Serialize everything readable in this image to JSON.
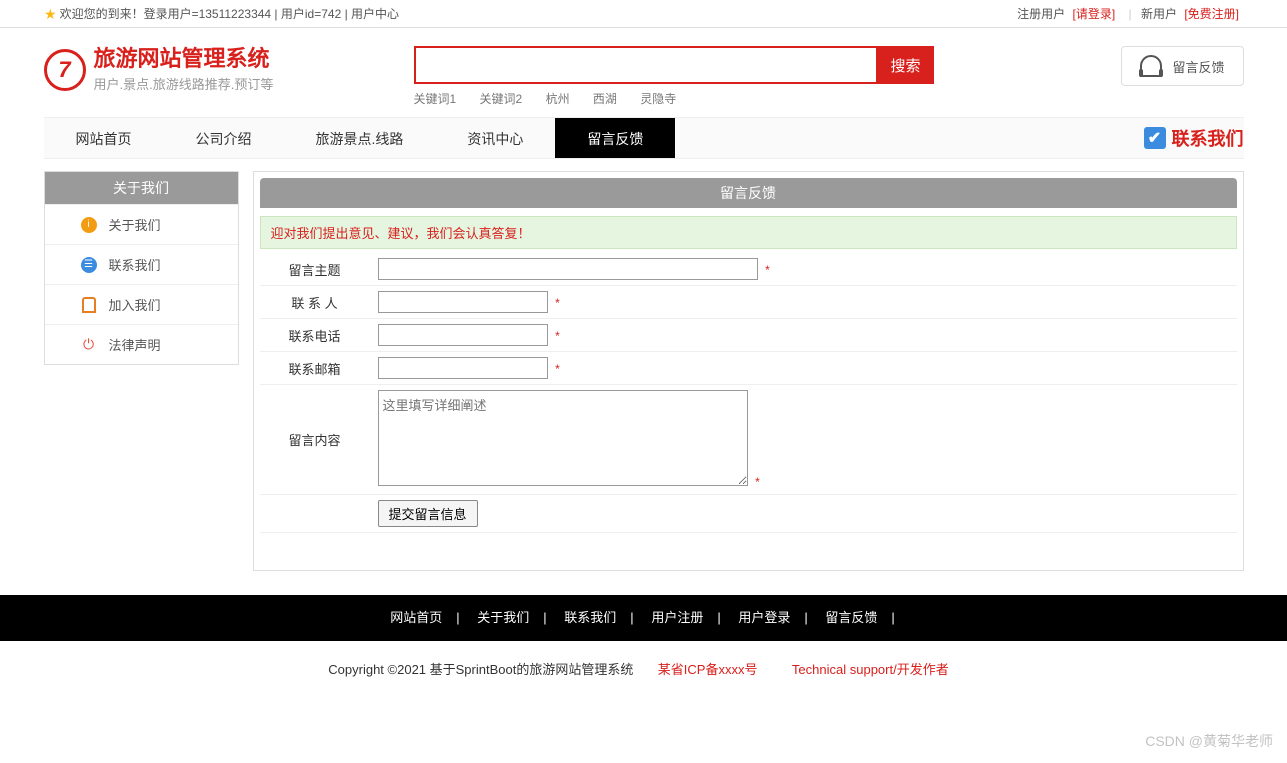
{
  "topbar": {
    "welcome": "欢迎您的到来！登录用户=13511223344 | 用户id=742 | 用户中心",
    "reg_user_label": "注册用户",
    "login_link": "[请登录]",
    "new_user_label": "新用户",
    "free_reg_link": "[免费注册]"
  },
  "header": {
    "site_title": "旅游网站管理系统",
    "site_sub": "用户.景点.旅游线路推荐.预订等",
    "search_button": "搜索",
    "keywords": [
      "关键词1",
      "关键词2",
      "杭州",
      "西湖",
      "灵隐寺"
    ],
    "feedback_btn": "留言反馈"
  },
  "nav": {
    "items": [
      "网站首页",
      "公司介绍",
      "旅游景点.线路",
      "资讯中心",
      "留言反馈"
    ],
    "active_index": 4,
    "contact_us": "联系我们"
  },
  "sidebar": {
    "header": "关于我们",
    "items": [
      {
        "label": "关于我们",
        "icon": "orange",
        "glyph": "i"
      },
      {
        "label": "联系我们",
        "icon": "blue",
        "glyph": "☰"
      },
      {
        "label": "加入我们",
        "icon": "red",
        "glyph": ""
      },
      {
        "label": "法律声明",
        "icon": "power",
        "glyph": "⏻"
      }
    ]
  },
  "content": {
    "panel_title": "留言反馈",
    "notice": "迎对我们提出意见、建议，我们会认真答复！",
    "fields": {
      "subject_label": "留言主题",
      "contact_label": "联 系 人",
      "phone_label": "联系电话",
      "email_label": "联系邮箱",
      "body_label": "留言内容",
      "textarea_placeholder": "这里填写详细阐述",
      "required_mark": "*",
      "submit_label": "提交留言信息"
    }
  },
  "footer": {
    "links": [
      "网站首页",
      "关于我们",
      "联系我们",
      "用户注册",
      "用户登录",
      "留言反馈"
    ],
    "copyright_prefix": "Copyright ©2021 基于SprintBoot的旅游网站管理系统",
    "icp": "某省ICP备xxxx号",
    "tech_support": "Technical support/开发作者"
  },
  "watermark": "CSDN @黄菊华老师"
}
